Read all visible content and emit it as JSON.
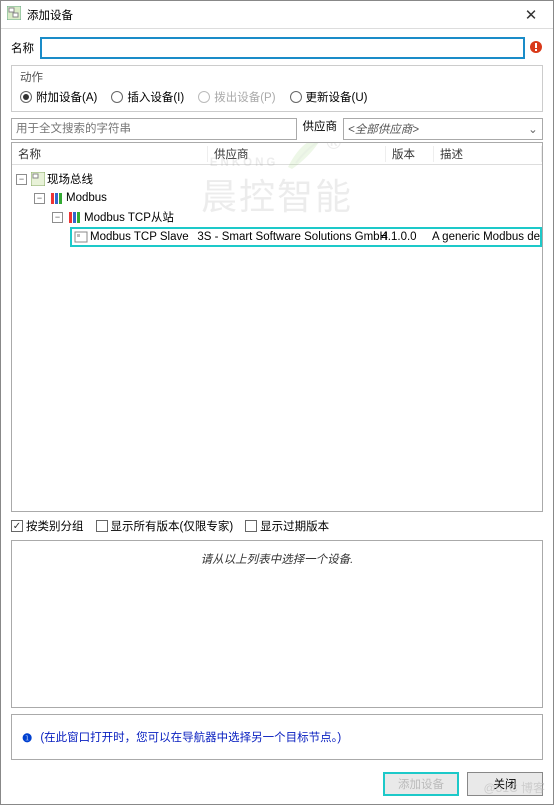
{
  "window": {
    "title": "添加设备"
  },
  "name": {
    "label": "名称",
    "value": ""
  },
  "actions": {
    "label": "动作",
    "append": "附加设备(A)",
    "insert": "插入设备(I)",
    "pull": "拨出设备(P)",
    "update": "更新设备(U)"
  },
  "search": {
    "placeholder": "用于全文搜索的字符串"
  },
  "supplier": {
    "label": "供应商",
    "all": "<全部供应商>"
  },
  "columns": {
    "name": "名称",
    "vendor": "供应商",
    "version": "版本",
    "desc": "描述"
  },
  "tree": {
    "root": "现场总线",
    "lvl1": "Modbus",
    "lvl2": "Modbus TCP从站",
    "device": {
      "name": "Modbus TCP Slave",
      "vendor": "3S - Smart Software Solutions GmbH",
      "version": "4.1.0.0",
      "desc": "A generic Modbus de"
    }
  },
  "checks": {
    "group": "按类别分组",
    "allver": "显示所有版本(仅限专家)",
    "expired": "显示过期版本"
  },
  "picker": {
    "hint": "请从以上列表中选择一个设备."
  },
  "hint": {
    "text": "(在此窗口打开时，您可以在导航器中选择另一个目标节点。)"
  },
  "buttons": {
    "add": "添加设备",
    "close": "关闭"
  },
  "watermark": {
    "brand_en": "ENKONG",
    "brand_cn": "晨控智能",
    "blog": "@51C  博客"
  }
}
